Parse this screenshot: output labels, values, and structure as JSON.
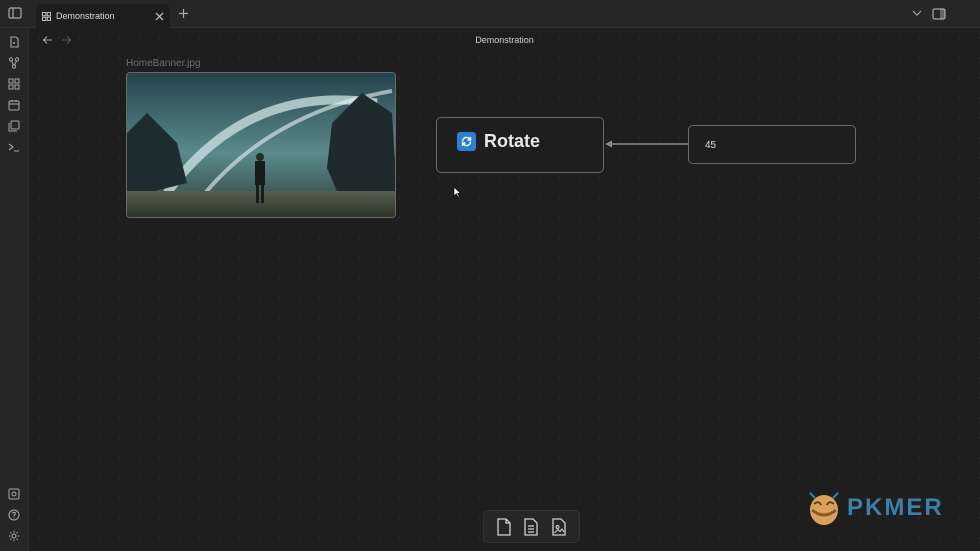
{
  "window": {
    "tab_title": "Demonstration",
    "view_title": "Demonstration"
  },
  "icons": {
    "sidebar_toggle": "sidebar-toggle-icon",
    "canvas": "canvas-icon",
    "close": "close-icon",
    "new_tab": "plus-icon",
    "tab_list": "chevron-down-icon",
    "right_sidebar": "right-sidebar-icon",
    "back": "arrow-left-icon",
    "forward": "arrow-right-icon"
  },
  "ribbon": {
    "top": [
      "open-quick-switcher-icon",
      "graph-icon",
      "canvas-icon",
      "calendar-icon",
      "templates-icon",
      "terminal-icon"
    ],
    "bottom": [
      "vault-icon",
      "help-icon",
      "settings-icon"
    ]
  },
  "canvas": {
    "image_node": {
      "file_label": "HomeBanner.jpg"
    },
    "rotate_node": {
      "label": "Rotate",
      "accent": "#2a7fd4"
    },
    "value_node": {
      "value": "45"
    },
    "edge_color": "#8a8a8a"
  },
  "toolbar": {
    "items": [
      "add-note-icon",
      "add-file-icon",
      "add-media-icon"
    ]
  },
  "brand": {
    "text": "PKMER",
    "color": "#3d7fa8"
  }
}
